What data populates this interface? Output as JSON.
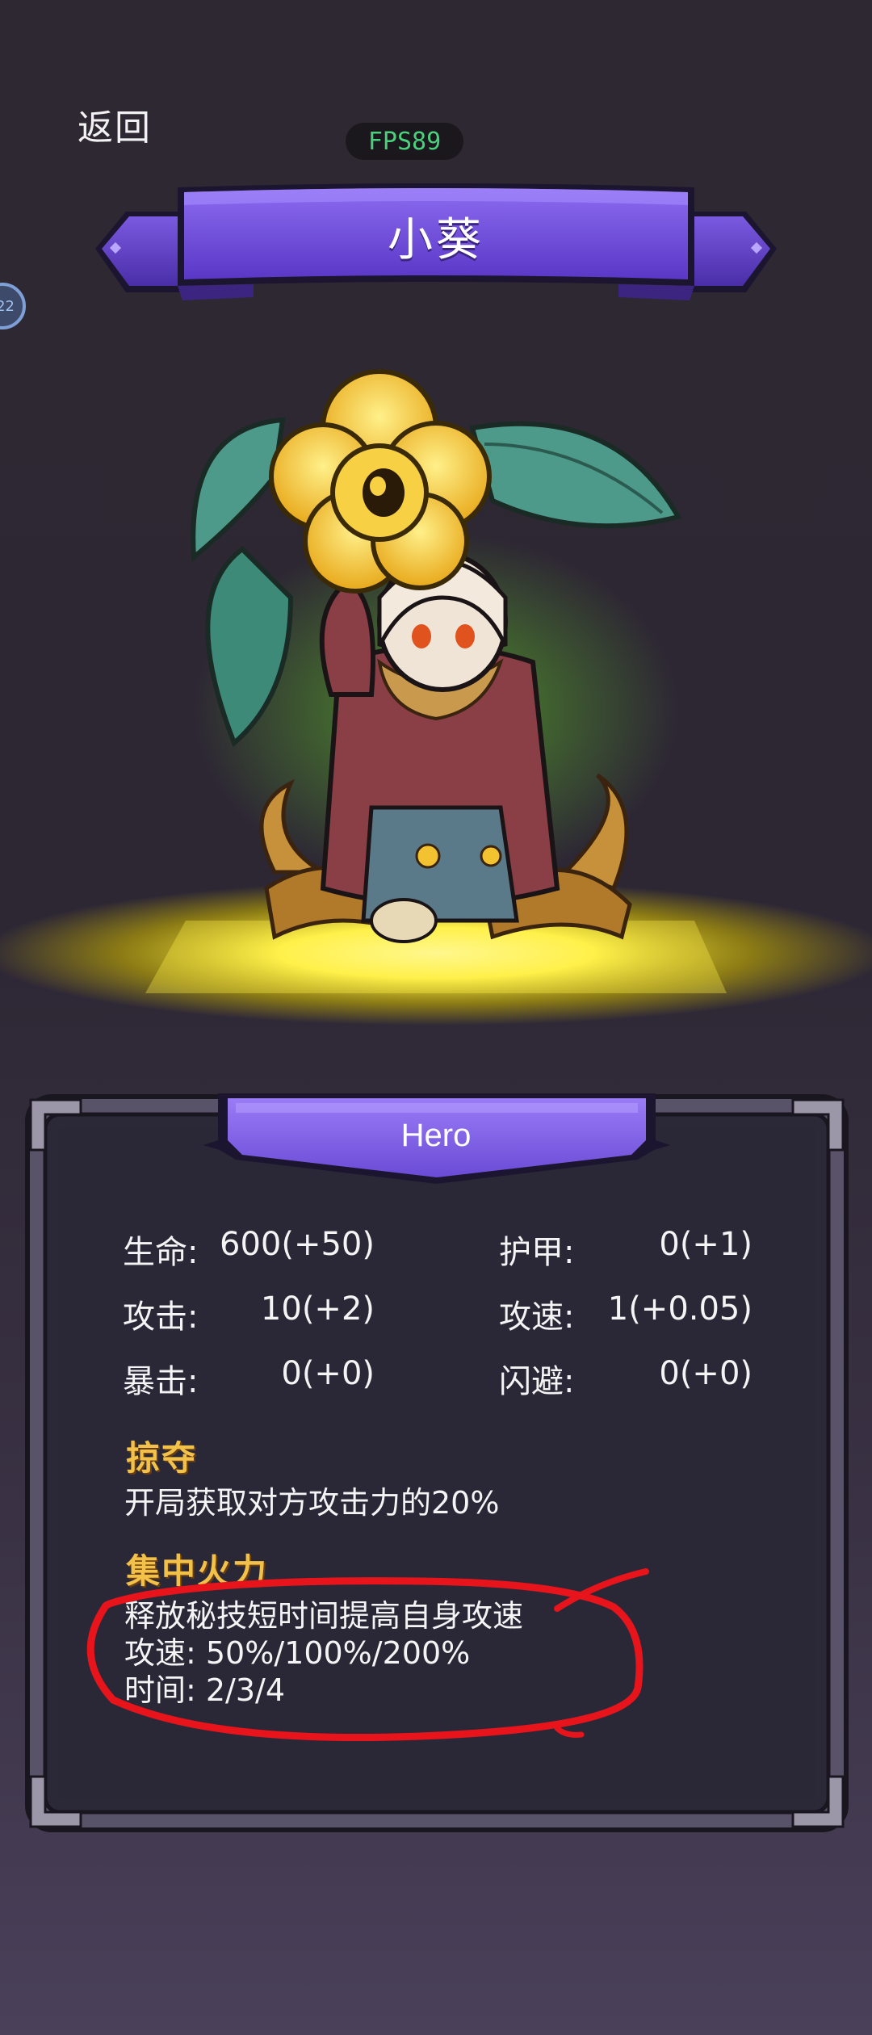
{
  "topbar": {
    "back_label": "返回",
    "fps_label": "FPS89",
    "side_badge": "22"
  },
  "banner": {
    "hero_name": "小葵"
  },
  "panel": {
    "title": "Hero",
    "stats": [
      {
        "label": "生命:",
        "value": "600(+50)"
      },
      {
        "label": "护甲:",
        "value": "0(+1)"
      },
      {
        "label": "攻击:",
        "value": "10(+2)"
      },
      {
        "label": "攻速:",
        "value": "1(+0.05)"
      },
      {
        "label": "暴击:",
        "value": "0(+0)"
      },
      {
        "label": "闪避:",
        "value": "0(+0)"
      }
    ],
    "skills": [
      {
        "name": "掠夺",
        "lines": [
          "开局获取对方攻击力的20%"
        ]
      },
      {
        "name": "集中火力",
        "lines": [
          "释放秘技短时间提高自身攻速",
          "攻速: 50%/100%/200%",
          "时间: 2/3/4"
        ]
      }
    ]
  },
  "colors": {
    "accent_purple": "#6a4bd6",
    "skill_gold": "#f2c14a",
    "fps_green": "#49d17c",
    "annotation_red": "#e8141c",
    "glow_yellow": "#ffe838"
  }
}
